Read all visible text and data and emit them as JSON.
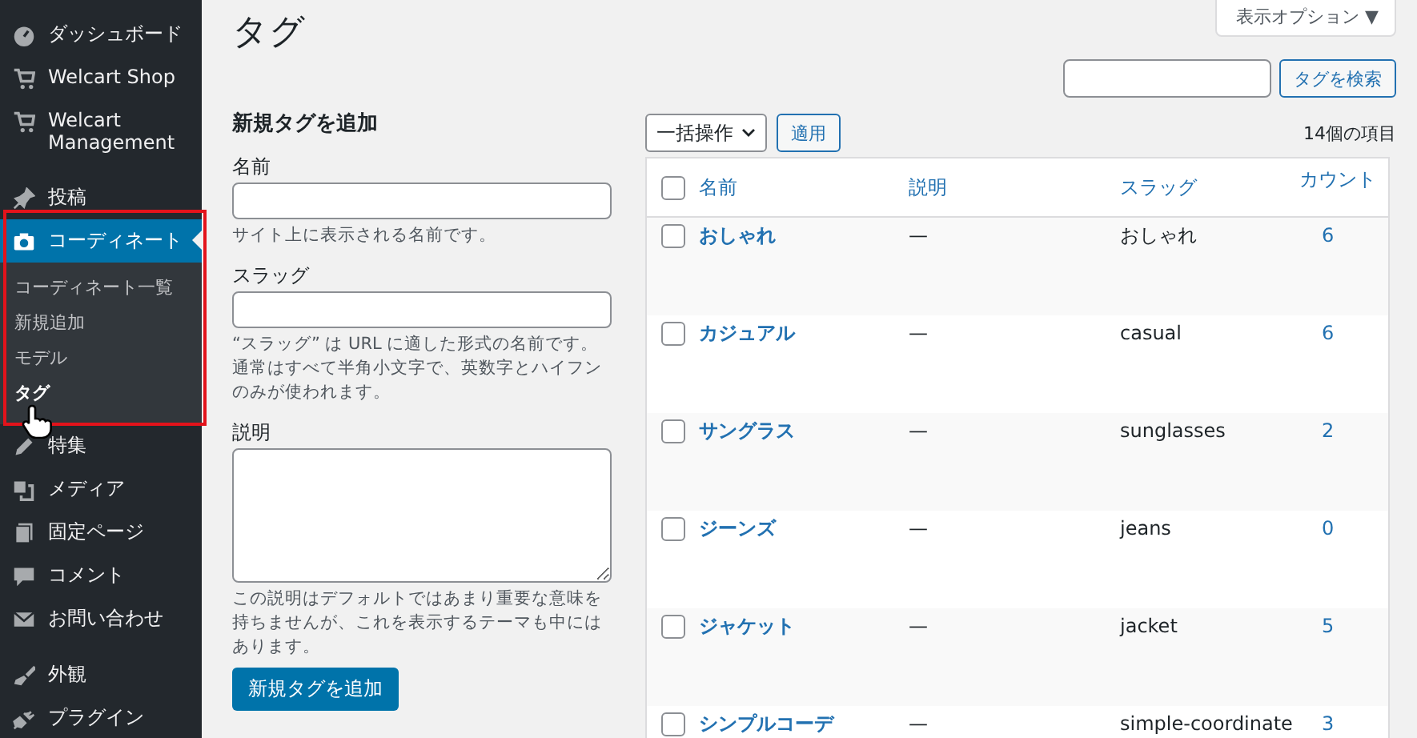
{
  "sidebar": {
    "groups": [
      [
        {
          "label": "ダッシュボード",
          "current": false
        },
        {
          "label": "Welcart Shop",
          "current": false
        },
        {
          "label": "Welcart Management",
          "current": false
        }
      ],
      [
        {
          "label": "投稿",
          "current": false
        },
        {
          "label": "コーディネート",
          "current": true,
          "submenu": [
            {
              "label": "コーディネート一覧",
              "selected": false
            },
            {
              "label": "新規追加",
              "selected": false
            },
            {
              "label": "モデル",
              "selected": false
            },
            {
              "label": "タグ",
              "selected": true
            }
          ]
        },
        {
          "label": "特集",
          "current": false
        },
        {
          "label": "メディア",
          "current": false
        },
        {
          "label": "固定ページ",
          "current": false
        },
        {
          "label": "コメント",
          "current": false
        },
        {
          "label": "お問い合わせ",
          "current": false
        }
      ],
      [
        {
          "label": "外観",
          "current": false
        },
        {
          "label": "プラグイン",
          "current": false
        }
      ]
    ]
  },
  "page": {
    "title": "タグ",
    "screen_options": "表示オプション ▼"
  },
  "add_form": {
    "heading": "新規タグを追加",
    "fields": [
      {
        "kind": "input",
        "label": "名前",
        "hint": "サイト上に表示される名前です。"
      },
      {
        "kind": "input",
        "label": "スラッグ",
        "hint": "“スラッグ” は URL に適した形式の名前です。通常はすべて半角小文字で、英数字とハイフンのみが使われます。"
      },
      {
        "kind": "textarea",
        "label": "説明",
        "hint": "この説明はデフォルトではあまり重要な意味を持ちませんが、これを表示するテーマも中にはあります。"
      }
    ],
    "submit": "新規タグを追加"
  },
  "search": {
    "button": "タグを検索"
  },
  "tablenav": {
    "bulk_action": "一括操作",
    "apply": "適用",
    "count": "14個の項目"
  },
  "table": {
    "columns": [
      "名前",
      "説明",
      "スラッグ",
      "カウント"
    ],
    "select_all_checked": false,
    "rows": [
      {
        "name": "おしゃれ",
        "description": "—",
        "slug": "おしゃれ",
        "count": "6",
        "checked": false
      },
      {
        "name": "カジュアル",
        "description": "—",
        "slug": "casual",
        "count": "6",
        "checked": false
      },
      {
        "name": "サングラス",
        "description": "—",
        "slug": "sunglasses",
        "count": "2",
        "checked": false
      },
      {
        "name": "ジーンズ",
        "description": "—",
        "slug": "jeans",
        "count": "0",
        "checked": false
      },
      {
        "name": "ジャケット",
        "description": "—",
        "slug": "jacket",
        "count": "5",
        "checked": false
      },
      {
        "name": "シンプルコーデ",
        "description": "—",
        "slug": "simple-coordinate",
        "count": "3",
        "checked": false
      }
    ]
  }
}
